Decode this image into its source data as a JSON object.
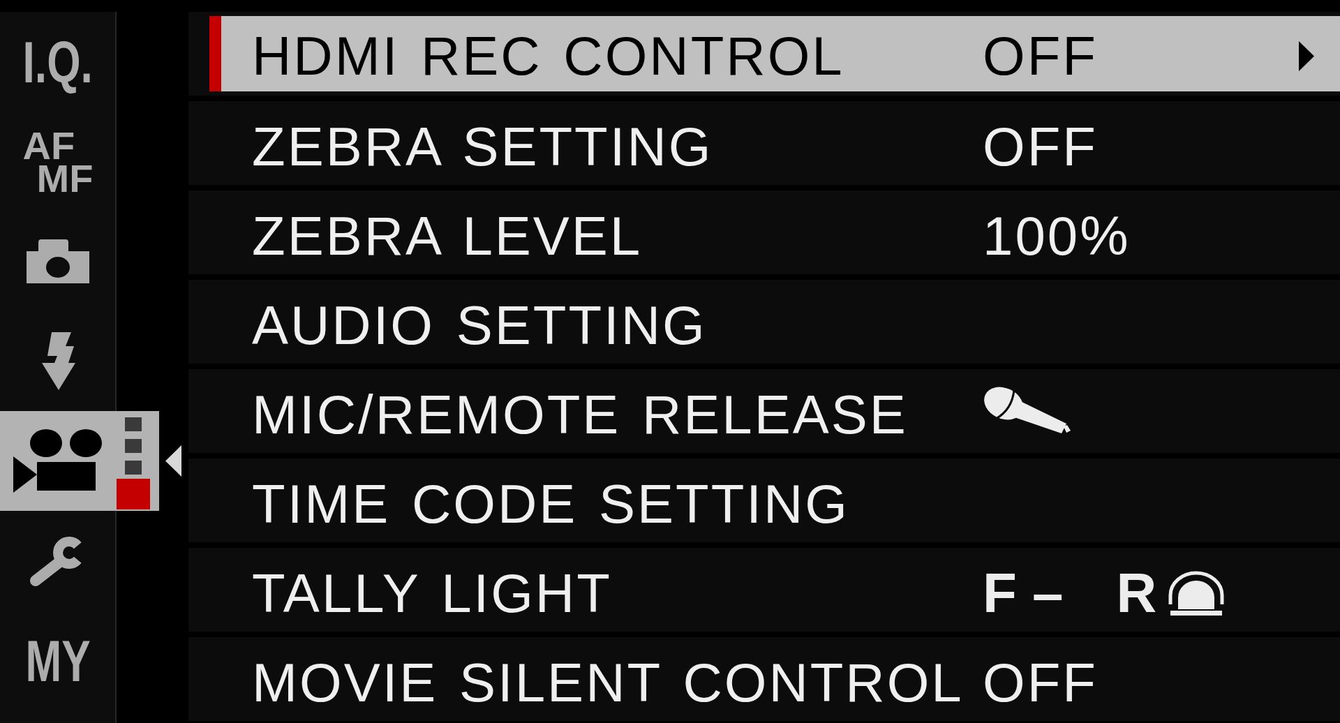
{
  "sidebar": {
    "items": [
      {
        "kind": "text",
        "label": "I.Q.",
        "selected": false
      },
      {
        "kind": "stacked",
        "lines": [
          "AF",
          "MF"
        ],
        "selected": false
      },
      {
        "kind": "camera",
        "selected": false
      },
      {
        "kind": "flash",
        "selected": false
      },
      {
        "kind": "movie",
        "selected": true
      },
      {
        "kind": "wrench",
        "selected": false
      },
      {
        "kind": "text",
        "label": "MY",
        "selected": false
      }
    ],
    "pages": [
      {
        "selected": false
      },
      {
        "selected": false
      },
      {
        "selected": false
      },
      {
        "selected": true
      }
    ]
  },
  "menu": {
    "rows": [
      {
        "label": "HDMI REC CONTROL",
        "selected": true,
        "kind": "text",
        "value": "OFF"
      },
      {
        "label": "ZEBRA SETTING",
        "selected": false,
        "kind": "text",
        "value": "OFF"
      },
      {
        "label": "ZEBRA LEVEL",
        "selected": false,
        "kind": "text",
        "value": "100%"
      },
      {
        "label": "AUDIO SETTING",
        "selected": false,
        "kind": "none"
      },
      {
        "label": "MIC/REMOTE RELEASE",
        "selected": false,
        "kind": "mic"
      },
      {
        "label": "TIME CODE SETTING",
        "selected": false,
        "kind": "none"
      },
      {
        "label": "TALLY LIGHT",
        "selected": false,
        "kind": "tally",
        "front": "F –",
        "rear": "R"
      },
      {
        "label": "MOVIE SILENT CONTROL",
        "selected": false,
        "kind": "text",
        "value": "OFF"
      }
    ]
  }
}
